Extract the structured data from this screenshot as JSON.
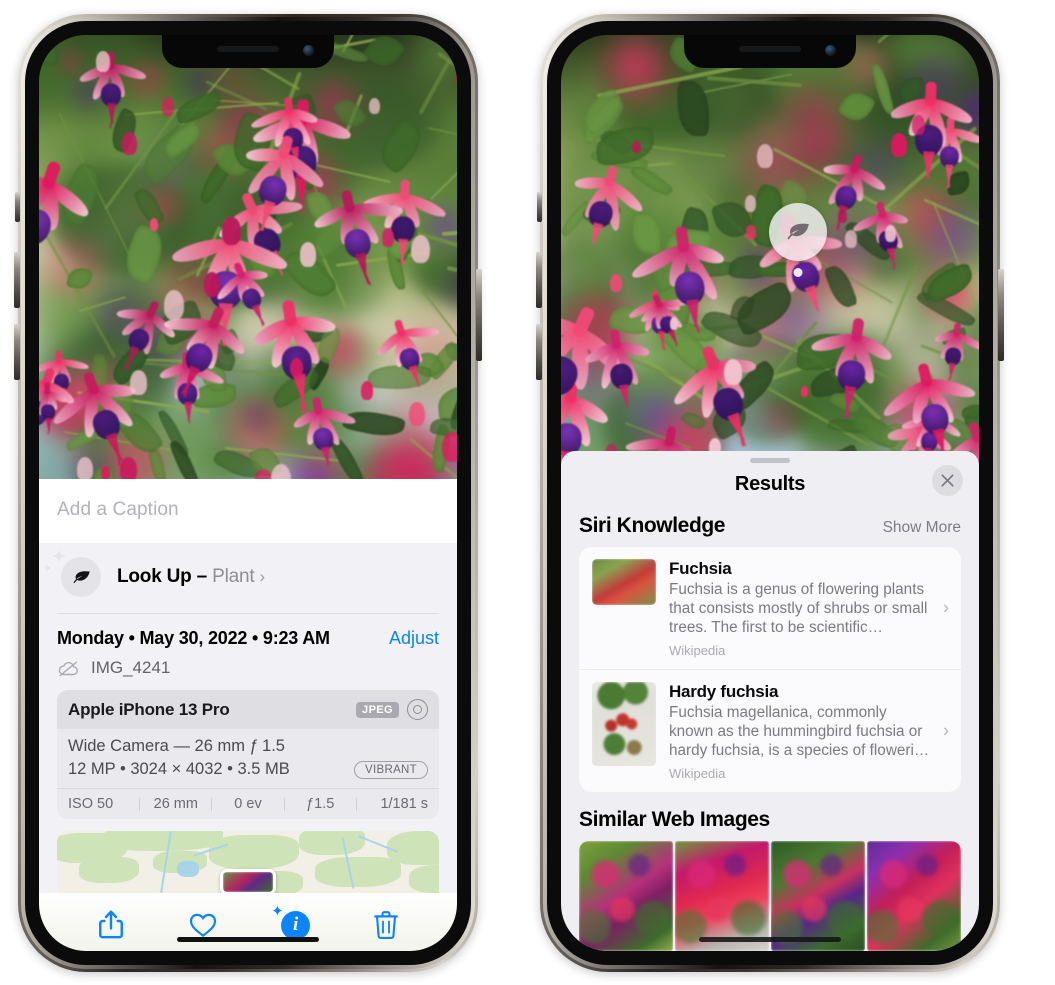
{
  "left_phone": {
    "name": "photos-detail-view",
    "caption": {
      "placeholder": "Add a Caption",
      "value": ""
    },
    "lookup": {
      "icon": "leaf-icon",
      "label": "Look Up – ",
      "subject": "Plant",
      "chevron": "›"
    },
    "date": {
      "text": "Monday • May 30, 2022 • 9:23 AM",
      "adjust_label": "Adjust",
      "cloud_icon": "cloud-slash-icon",
      "filename": "IMG_4241"
    },
    "exif": {
      "device": "Apple iPhone 13 Pro",
      "format_badge": "JPEG",
      "aperture_icon": "aperture-icon",
      "lens_line": "Wide Camera — 26 mm ƒ 1.5",
      "size_line": "12 MP • 3024 × 4032 • 3.5 MB",
      "style_badge": "VIBRANT",
      "stats": [
        "ISO 50",
        "26 mm",
        "0 ev",
        "ƒ1.5",
        "1/181 s"
      ]
    },
    "toolbar": [
      {
        "name": "share-button",
        "icon": "share-icon"
      },
      {
        "name": "favorite-button",
        "icon": "heart-icon"
      },
      {
        "name": "info-button",
        "icon": "info-sparkle-icon"
      },
      {
        "name": "delete-button",
        "icon": "trash-icon"
      }
    ]
  },
  "right_phone": {
    "name": "visual-lookup-results",
    "badge": {
      "icon": "leaf-icon"
    },
    "header": {
      "title": "Results",
      "close_icon": "close-icon"
    },
    "siri_knowledge": {
      "title": "Siri Knowledge",
      "show_more": "Show More",
      "items": [
        {
          "title": "Fuchsia",
          "description": "Fuchsia is a genus of flowering plants that consists mostly of shrubs or small trees. The first to be scientific…",
          "source": "Wikipedia",
          "chevron": "›"
        },
        {
          "title": "Hardy fuchsia",
          "description": "Fuchsia magellanica, commonly known as the hummingbird fuchsia or hardy fuchsia, is a species of floweri…",
          "source": "Wikipedia",
          "chevron": "›"
        }
      ]
    },
    "similar_web_images": {
      "title": "Similar Web Images",
      "count": 4
    }
  },
  "colors": {
    "accent_blue": "#0a84ff",
    "sheet_bg": "#f2f2f6",
    "results_bg": "#eeeef3",
    "card_bg": "#fbfbfd",
    "secondary_text": "#8e8e93"
  }
}
